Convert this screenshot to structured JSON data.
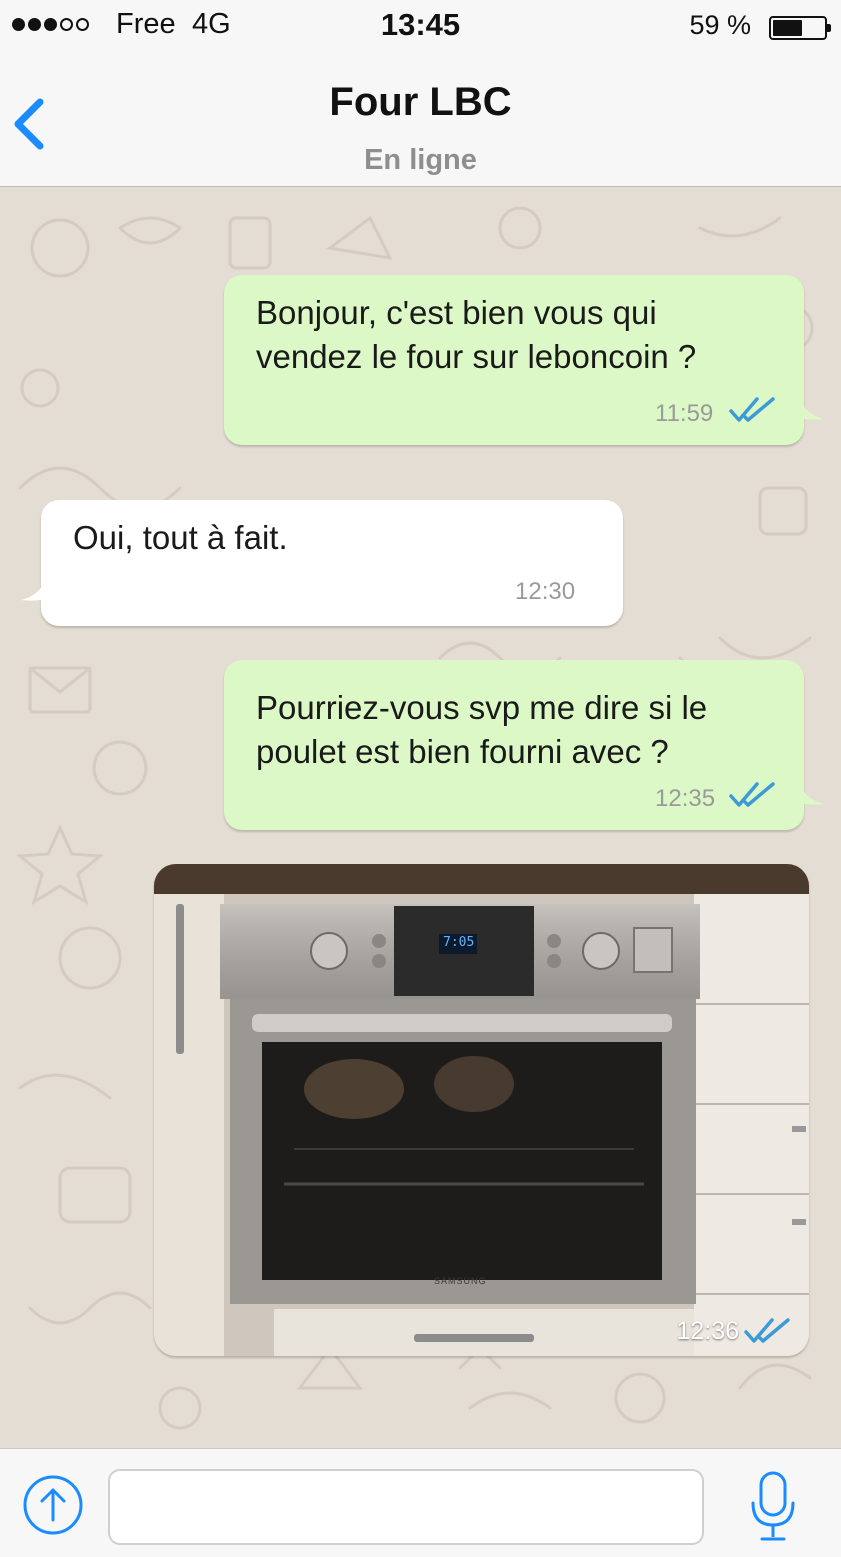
{
  "status_bar": {
    "signal_dots": [
      true,
      true,
      true,
      false,
      false
    ],
    "carrier": "Free",
    "network": "4G",
    "time": "13:45",
    "battery_percent": "59 %",
    "battery_level": 0.59
  },
  "header": {
    "back_icon": "chevron-left-icon",
    "contact_name": "Four LBC",
    "contact_status": "En ligne"
  },
  "messages": [
    {
      "direction": "outgoing",
      "text_lines": [
        "Bonjour, c'est bien vous qui",
        "vendez le four sur leboncoin ?"
      ],
      "time": "11:59",
      "read": true
    },
    {
      "direction": "incoming",
      "text_lines": [
        "Oui, tout à fait."
      ],
      "time": "12:30"
    },
    {
      "direction": "outgoing",
      "text_lines": [
        "Pourriez-vous svp me dire si le",
        "poulet est bien fourni avec ?"
      ],
      "time": "12:35",
      "read": true
    },
    {
      "direction": "outgoing",
      "type": "photo",
      "photo_subject": "oven",
      "oven_display": "7:05",
      "oven_brand": "SAMSUNG",
      "time": "12:36",
      "read": true
    }
  ],
  "input_bar": {
    "attach_icon": "upload-arrow-icon",
    "placeholder": "",
    "mic_icon": "microphone-icon"
  },
  "colors": {
    "accent": "#1a8cff",
    "outgoing_bubble": "#dcf8c6",
    "incoming_bubble": "#ffffff",
    "chat_background": "#e4ddd3",
    "read_ticks": "#3c9ad8"
  }
}
